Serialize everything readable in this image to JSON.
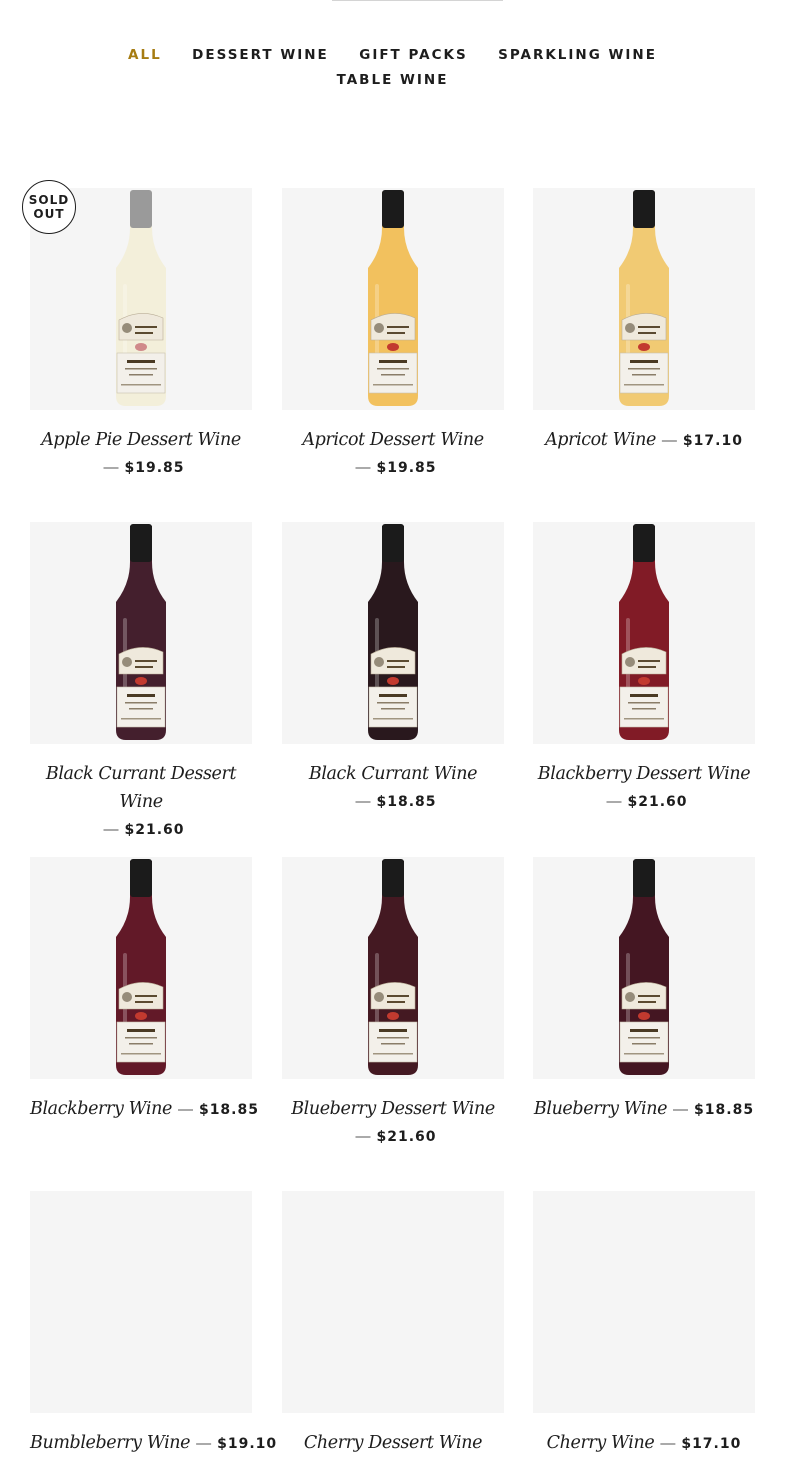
{
  "filters": [
    {
      "label": "ALL",
      "active": true
    },
    {
      "label": "DESSERT WINE",
      "active": false
    },
    {
      "label": "GIFT PACKS",
      "active": false
    },
    {
      "label": "SPARKLING WINE",
      "active": false
    },
    {
      "label": "TABLE WINE",
      "active": false
    }
  ],
  "badge": {
    "sold_out_line1": "SOLD",
    "sold_out_line2": "OUT"
  },
  "products": [
    {
      "title": "Apple Pie Dessert Wine",
      "price": "$19.85",
      "dash": "—",
      "wine_color": "#f1ecd0",
      "cap_color": "#9a9a9a",
      "sold_out": true
    },
    {
      "title": "Apricot Dessert Wine",
      "price": "$19.85",
      "dash": "—",
      "wine_color": "#f1be55",
      "cap_color": "#1b1b1b",
      "sold_out": false
    },
    {
      "title": "Apricot Wine",
      "price": "$17.10",
      "dash": "—",
      "wine_color": "#f0c76c",
      "cap_color": "#1b1b1b",
      "sold_out": false
    },
    {
      "title": "Black Currant Dessert Wine",
      "price": "$21.60",
      "dash": "—",
      "wine_color": "#3a1322",
      "cap_color": "#1b1b1b",
      "sold_out": false
    },
    {
      "title": "Black Currant Wine",
      "price": "$18.85",
      "dash": "—",
      "wine_color": "#1e0c11",
      "cap_color": "#1b1b1b",
      "sold_out": false
    },
    {
      "title": "Blackberry Dessert Wine",
      "price": "$21.60",
      "dash": "—",
      "wine_color": "#7a0f1a",
      "cap_color": "#1b1b1b",
      "sold_out": false
    },
    {
      "title": "Blackberry Wine",
      "price": "$18.85",
      "dash": "—",
      "wine_color": "#5a0d1c",
      "cap_color": "#1b1b1b",
      "sold_out": false
    },
    {
      "title": "Blueberry Dessert Wine",
      "price": "$21.60",
      "dash": "—",
      "wine_color": "#3a0d16",
      "cap_color": "#1b1b1b",
      "sold_out": false
    },
    {
      "title": "Blueberry Wine",
      "price": "$18.85",
      "dash": "—",
      "wine_color": "#3a0a16",
      "cap_color": "#1b1b1b",
      "sold_out": false
    },
    {
      "title": "Bumbleberry Wine",
      "price": "$19.10",
      "dash": "—",
      "wine_color": null,
      "cap_color": null,
      "sold_out": false
    },
    {
      "title": "Cherry Dessert Wine",
      "price": "",
      "dash": "",
      "wine_color": null,
      "cap_color": null,
      "sold_out": false
    },
    {
      "title": "Cherry Wine",
      "price": "$17.10",
      "dash": "—",
      "wine_color": null,
      "cap_color": null,
      "sold_out": false
    }
  ],
  "colors": {
    "accent": "#a67c12",
    "text": "#1d1d1d",
    "tile_bg": "#f5f5f5"
  }
}
